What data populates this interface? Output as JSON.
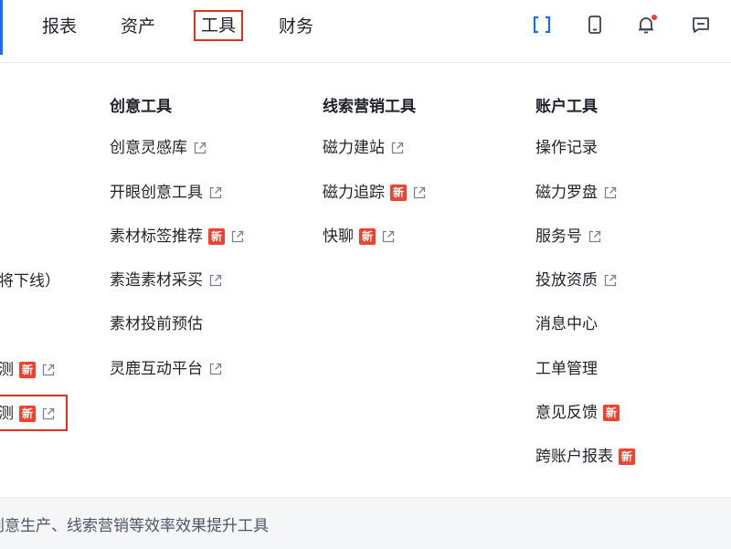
{
  "nav": {
    "items": [
      "报表",
      "资产",
      "工具",
      "财务"
    ],
    "active": "工具",
    "icons": [
      "scan-icon",
      "mobile-icon",
      "bell-icon",
      "message-icon"
    ],
    "accent_color": "#1a6df0",
    "highlight_color": "#e0301e"
  },
  "left_partial": {
    "items": [
      {
        "label": "将下线）"
      },
      {
        "label": "测",
        "badge": "新",
        "external": true
      },
      {
        "label": "测",
        "badge": "新",
        "external": true
      }
    ]
  },
  "columns": [
    {
      "title": "创意工具",
      "items": [
        {
          "label": "创意灵感库",
          "external": true
        },
        {
          "label": "开眼创意工具",
          "external": true
        },
        {
          "label": "素材标签推荐",
          "badge": "新",
          "external": true
        },
        {
          "label": "素造素材采买",
          "external": true
        },
        {
          "label": "素材投前预估"
        },
        {
          "label": "灵鹿互动平台",
          "external": true
        }
      ]
    },
    {
      "title": "线索营销工具",
      "items": [
        {
          "label": "磁力建站",
          "external": true
        },
        {
          "label": "磁力追踪",
          "badge": "新",
          "external": true
        },
        {
          "label": "快聊",
          "badge": "新",
          "external": true
        }
      ]
    },
    {
      "title": "账户工具",
      "items": [
        {
          "label": "操作记录"
        },
        {
          "label": "磁力罗盘",
          "external": true
        },
        {
          "label": "服务号",
          "external": true
        },
        {
          "label": "投放资质",
          "external": true
        },
        {
          "label": "消息中心"
        },
        {
          "label": "工单管理"
        },
        {
          "label": "意见反馈",
          "badge": "新"
        },
        {
          "label": "跨账户报表",
          "badge": "新"
        }
      ]
    }
  ],
  "footer": {
    "text": "创意生产、线索营销等效率效果提升工具"
  }
}
